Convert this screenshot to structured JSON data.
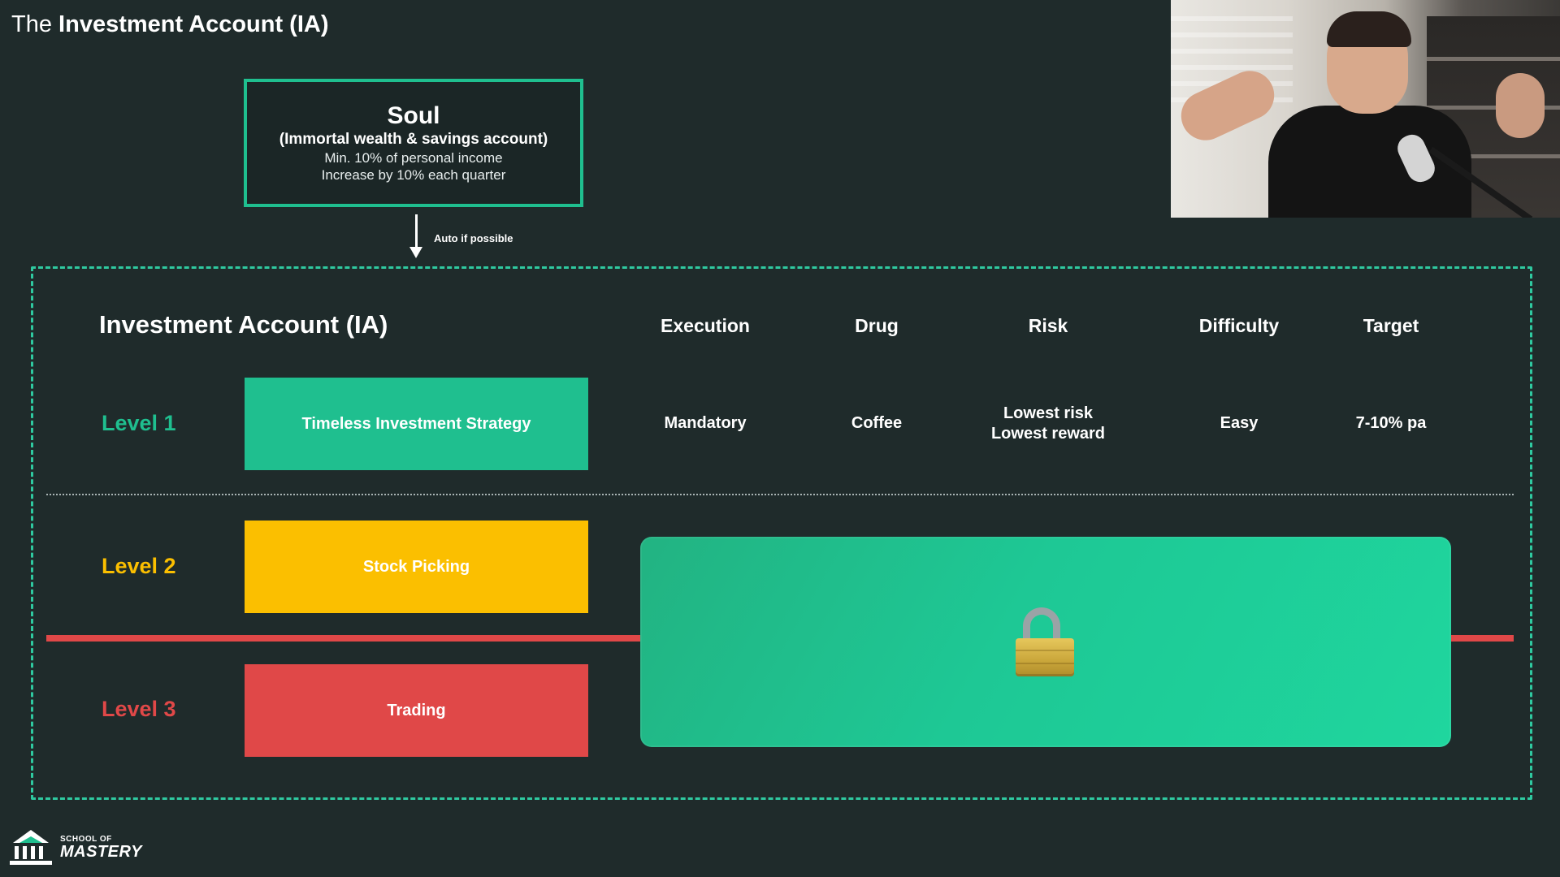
{
  "header": {
    "title_prefix": "The",
    "title_bold": "Investment Account (IA)"
  },
  "soul": {
    "title": "Soul",
    "subtitle": "(Immortal wealth & savings account)",
    "line1": "Min. 10% of personal income",
    "line2": "Increase by 10% each quarter"
  },
  "flow": {
    "arrow_label": "Auto if possible"
  },
  "table": {
    "heading": "Investment Account (IA)",
    "columns": [
      "Execution",
      "Drug",
      "Risk",
      "Difficulty",
      "Target"
    ],
    "levels": [
      {
        "label": "Level 1",
        "strategy": "Timeless Investment Strategy",
        "color": "#1fbf8f",
        "values": {
          "execution": "Mandatory",
          "drug": "Coffee",
          "risk_line1": "Lowest risk",
          "risk_line2": "Lowest reward",
          "difficulty": "Easy",
          "target": "7-10% pa"
        }
      },
      {
        "label": "Level 2",
        "strategy": "Stock Picking",
        "color": "#fbbf00"
      },
      {
        "label": "Level 3",
        "strategy": "Trading",
        "color": "#e04848"
      }
    ],
    "locked_icon": "padlock-icon"
  },
  "logo": {
    "line1": "SCHOOL OF",
    "line2": "MASTERY"
  },
  "colors": {
    "background": "#1f2b2b",
    "accent_green": "#1fbf8f",
    "yellow": "#fbbf00",
    "red": "#e04848"
  }
}
